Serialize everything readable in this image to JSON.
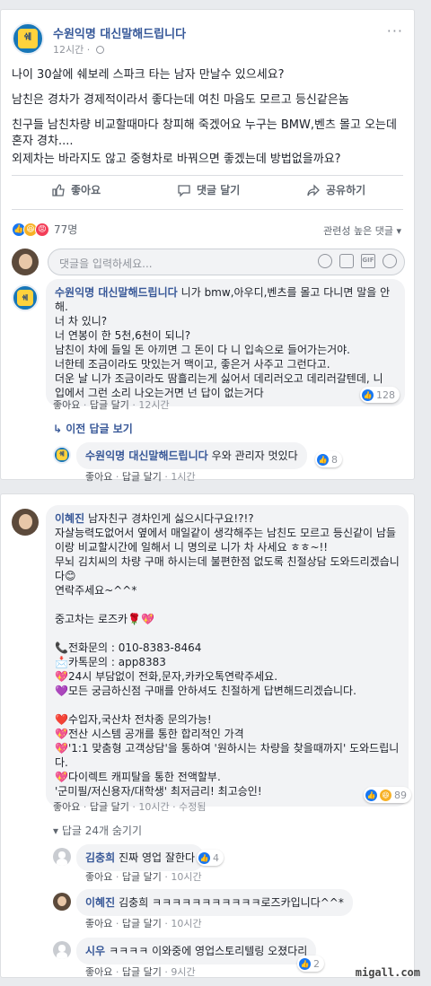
{
  "post": {
    "page_name": "수원익명 대신말해드립니다",
    "time": "12시간",
    "lines": [
      "나이 30살에 쉐보레 스파크 타는 남자 만날수 있으세요?",
      "남친은 경차가 경제적이라서 좋다는데 여친 마음도 모르고 등신같은놈",
      "친구들 남친차량 비교할때마다 창피해 죽겠어요 누구는 BMW,벤츠 몰고 오는데 혼자 경차....",
      "외제차는 바라지도 않고 중형차로 바꿔으면 좋겠는데 방법없을까요?"
    ],
    "actions": {
      "like": "좋아요",
      "comment": "댓글 달기",
      "share": "공유하기"
    },
    "reaction_count": "77명",
    "sort_label": "관련성 높은 댓글",
    "compose_placeholder": "댓글을 입력하세요..."
  },
  "comment1": {
    "author": "수원익명 대신말해드립니다",
    "lines": [
      "니가 bmw,아우디,벤츠를 몰고 다니면 말을 안해.",
      "너 차 있니?",
      "너 연봉이 한 5천,6천이 되니?",
      "남친이 차에 들일 돈 아끼면 그 돈이 다 니 입속으로 들어가는거야.",
      "너한테 조금이라도 맛있는거 맥이고, 좋은거 사주고 그런다고.",
      "더운 날 니가 조금이라도 땀흘리는게 싫어서 데리러오고 데리러갈텐데, 니 입에서 그런 소리 나오는거면 넌 답이 없는거다"
    ],
    "like": "좋아요",
    "reply": "답글 달기",
    "time": "12시간",
    "reactions": "128",
    "view_replies": "이전 답글 보기"
  },
  "reply1": {
    "author": "수원익명 대신말해드립니다",
    "text": "우와 관리자 멋있다",
    "like": "좋아요",
    "reply": "답글 달기",
    "time": "1시간",
    "reactions": "8"
  },
  "comment2": {
    "author": "이혜진",
    "lines": [
      "남자친구 경차인게 싫으시다구요!?!?",
      "자살능력도없어서 옆에서 매일같이 생각해주는 남친도 모르고 등신같이 남들이랑 비교할시간에 일해서 니 명의로 니가 차 사세요 ㅎㅎ~!!",
      "무뇌 김치씨의 차량 구매 하시는데 불편한점 없도록 친절상담 도와드리겠습니다😊",
      "연락주세요~^^*",
      "",
      "중고차는 로즈카🌹💖",
      "",
      "📞전화문의 : 010-8383-8464",
      "📩카톡문의 : app8383",
      "💖24시 부담없이 전화,문자,카카오톡연락주세요.",
      "💜모든 궁금하신점 구매를 안하셔도 친절하게 답변해드리겠습니다.",
      "",
      "❤️수입자,국산차 전차종 문의가능!",
      "💖전산 시스템 공개를 통한 합리적인 가격",
      "💖'1:1 맞춤형 고객상담'을 통하여 '원하시는 차량을 찾을때까지' 도와드립니다.",
      "💖다이렉트 캐피탈을 통한 전액할부.",
      "'군미필/저신용자/대학생' 최저금리! 최고승인!"
    ],
    "like": "좋아요",
    "reply": "답글 달기",
    "time": "10시간",
    "edited": "수정됨",
    "reactions": "89",
    "hide_replies": "답글 24개 숨기기"
  },
  "reply2": {
    "author": "김충희",
    "text": "진짜 영업 잘한다",
    "like": "좋아요",
    "reply": "답글 달기",
    "time": "10시간",
    "reactions": "4"
  },
  "reply3": {
    "author": "이혜진",
    "text": "김충희 ㅋㅋㅋㅋㅋㅋㅋㅋㅋㅋㅋ로즈카입니다^^*",
    "like": "좋아요",
    "reply": "답글 달기",
    "time": "10시간"
  },
  "reply4": {
    "author": "시우",
    "text": "ㅋㅋㅋㅋ 이와중에 영업스토리텔링 오졌다리",
    "like": "좋아요",
    "reply": "답글 달기",
    "time": "9시간",
    "reactions": "2"
  },
  "watermark": "migall.com",
  "icons": {
    "logo_text": "쉐",
    "dots": "···",
    "laugh": "😆",
    "angry": "😡",
    "like": "👍"
  }
}
